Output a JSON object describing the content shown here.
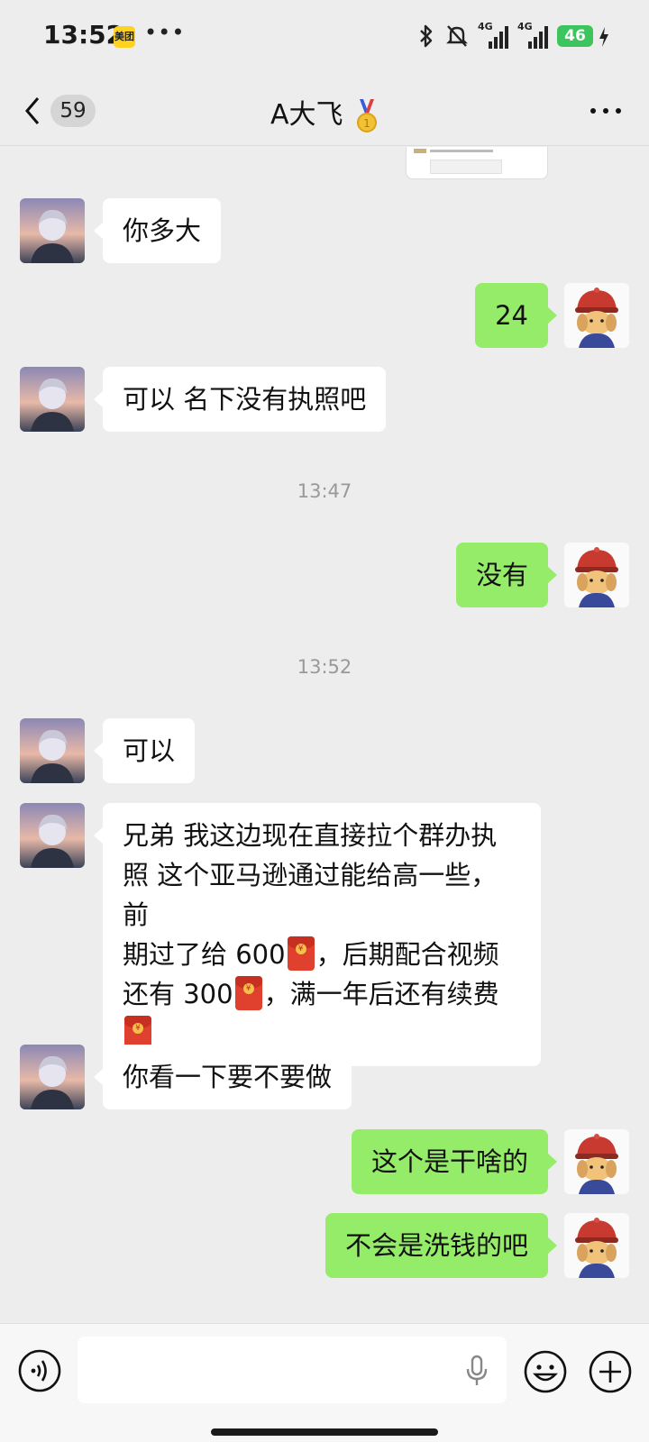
{
  "status_bar": {
    "time": "13:52",
    "app_badge": "美团",
    "more": "•••",
    "network_1": "4G",
    "network_2": "4G",
    "battery": "46"
  },
  "nav": {
    "unread_count": "59",
    "title": "A大飞"
  },
  "messages": [
    {
      "side": "in",
      "text": "你多大"
    },
    {
      "side": "out",
      "text": "24"
    },
    {
      "side": "in",
      "text": "可以 名下没有执照吧"
    },
    {
      "type": "time",
      "text": "13:47"
    },
    {
      "side": "out",
      "text": "没有"
    },
    {
      "type": "time",
      "text": "13:52"
    },
    {
      "side": "in",
      "text": "可以"
    },
    {
      "side": "in",
      "line1": "兄弟 我这边现在直接拉个群办执",
      "line2": "照 这个亚马逊通过能给高一些，前",
      "line3_a": "期过了给 600",
      "line3_b": "，后期配合视频",
      "line4_a": "还有 300",
      "line4_b": "，满一年后还有续费"
    },
    {
      "side": "in",
      "text": "你看一下要不要做"
    },
    {
      "side": "out",
      "text": "这个是干啥的"
    },
    {
      "side": "out",
      "text": "不会是洗钱的吧"
    }
  ],
  "icons": {
    "back": "chevron-left-icon",
    "more": "more-dots-icon",
    "voice": "voice-icon",
    "mic": "mic-icon",
    "emoji": "emoji-icon",
    "plus": "plus-icon",
    "red_packet": "red-packet-icon"
  },
  "colors": {
    "outgoing_bubble": "#95ec69",
    "incoming_bubble": "#ffffff",
    "background": "#ededed",
    "battery": "#3cc55c"
  }
}
